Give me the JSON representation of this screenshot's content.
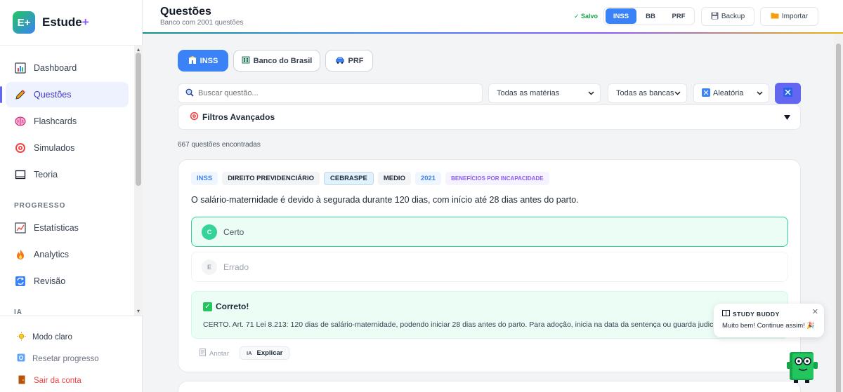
{
  "app": {
    "logo_text": "E+",
    "name": "Estude",
    "name_suffix": "+"
  },
  "sidebar": {
    "items": [
      {
        "label": "Dashboard",
        "icon": "chart-bar-icon"
      },
      {
        "label": "Questões",
        "icon": "pencil-icon",
        "active": true
      },
      {
        "label": "Flashcards",
        "icon": "brain-icon"
      },
      {
        "label": "Simulados",
        "icon": "target-icon"
      },
      {
        "label": "Teoria",
        "icon": "book-icon"
      }
    ],
    "section_progress": "PROGRESSO",
    "progress_items": [
      {
        "label": "Estatísticas",
        "icon": "chart-line-icon"
      },
      {
        "label": "Analytics",
        "icon": "fire-icon"
      },
      {
        "label": "Revisão",
        "icon": "refresh-icon"
      }
    ],
    "section_ia": "IA",
    "footer": {
      "theme": "Modo claro",
      "reset": "Resetar progresso",
      "logout": "Sair da conta"
    }
  },
  "header": {
    "title": "Questões",
    "subtitle": "Banco com 2001 questões",
    "saved": "✓ Salvo",
    "exam_toggle": [
      "INSS",
      "BB",
      "PRF"
    ],
    "exam_selected": "INSS",
    "backup": "Backup",
    "import": "Importar"
  },
  "bank_tabs": [
    {
      "label": "INSS",
      "active": true
    },
    {
      "label": "Banco do Brasil",
      "active": false
    },
    {
      "label": "PRF",
      "active": false
    }
  ],
  "search": {
    "placeholder": "Buscar questão...",
    "value": ""
  },
  "filters": {
    "subject": "Todas as matérias",
    "board": "Todas as bancas",
    "order": "Aleatória",
    "advanced": "Filtros Avançados"
  },
  "results_count": "667 questões encontradas",
  "question": {
    "tags": [
      "INSS",
      "DIREITO PREVIDENCIÁRIO",
      "CEBRASPE",
      "MEDIO",
      "2021",
      "BENEFÍCIOS POR INCAPACIDADE"
    ],
    "text": "O salário-maternidade é devido à segurada durante 120 dias, com início até 28 dias antes do parto.",
    "options": [
      {
        "letter": "C",
        "label": "Certo",
        "state": "correct"
      },
      {
        "letter": "E",
        "label": "Errado",
        "state": "neutral"
      }
    ],
    "feedback_title": "Correto!",
    "feedback_text": "CERTO. Art. 71 Lei 8.213: 120 dias de salário-maternidade, podendo iniciar 28 dias antes do parto. Para adoção, inicia na data da sentença ou guarda judicial.",
    "note_label": "Anotar",
    "explain_prefix": "IA",
    "explain_label": "Explicar"
  },
  "buddy": {
    "title": "STUDY BUDDY",
    "message": "Muito bem! Continue assim! 🎉"
  },
  "colors": {
    "primary": "#3b82f6",
    "accent": "#6366f1",
    "success": "#34d399",
    "danger": "#ef4444"
  }
}
